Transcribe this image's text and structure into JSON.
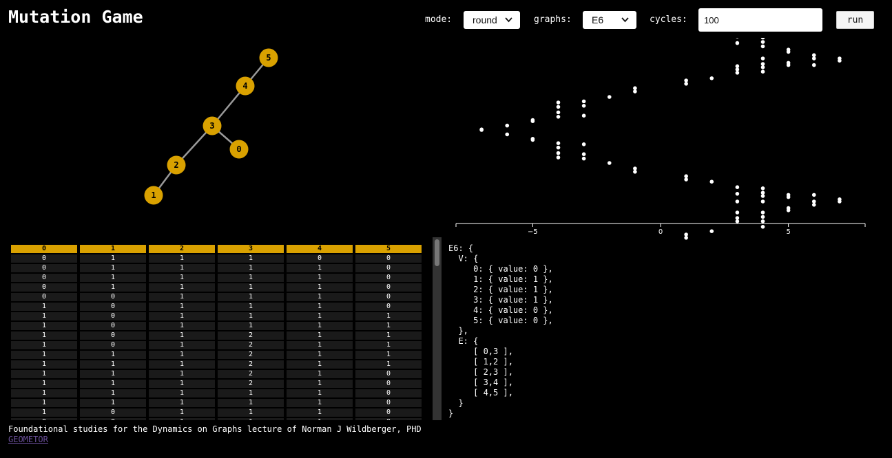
{
  "app": {
    "title": "Mutation Game"
  },
  "controls": {
    "mode_label": "mode:",
    "mode_value": "round",
    "graphs_label": "graphs:",
    "graphs_value": "E6",
    "cycles_label": "cycles:",
    "cycles_value": "100",
    "run_label": "run"
  },
  "colors": {
    "node": "#d9a100",
    "edge": "#9a9a9a",
    "header": "#d9a100",
    "link": "#6a4f9a"
  },
  "graph": {
    "nodes": [
      {
        "label": "0"
      },
      {
        "label": "1"
      },
      {
        "label": "2"
      },
      {
        "label": "3"
      },
      {
        "label": "4"
      },
      {
        "label": "5"
      }
    ],
    "edges": [
      [
        0,
        3
      ],
      [
        1,
        2
      ],
      [
        2,
        3
      ],
      [
        3,
        4
      ],
      [
        4,
        5
      ]
    ]
  },
  "chart_data": {
    "type": "scatter",
    "xlim": [
      -8,
      8
    ],
    "x_ticks": [
      -5,
      0,
      5
    ],
    "grid": false,
    "points": [
      [
        -7,
        0
      ],
      [
        -7,
        0.05
      ],
      [
        -6,
        0.4
      ],
      [
        -6,
        -0.4
      ],
      [
        -5,
        0.8
      ],
      [
        -5,
        0.9
      ],
      [
        -5,
        -0.8
      ],
      [
        -5,
        -0.9
      ],
      [
        -4,
        2.5
      ],
      [
        -4,
        2.1
      ],
      [
        -4,
        1.6
      ],
      [
        -4,
        1.2
      ],
      [
        -4,
        -1.2
      ],
      [
        -4,
        -1.6
      ],
      [
        -4,
        -2.1
      ],
      [
        -4,
        -2.5
      ],
      [
        -3,
        2.6
      ],
      [
        -3,
        2.2
      ],
      [
        -3,
        1.3
      ],
      [
        -3,
        -1.3
      ],
      [
        -3,
        -2.2
      ],
      [
        -3,
        -2.6
      ],
      [
        -2,
        3.0
      ],
      [
        -2,
        -3.0
      ],
      [
        -1,
        3.5
      ],
      [
        -1,
        3.8
      ],
      [
        -1,
        -3.5
      ],
      [
        -1,
        -3.8
      ],
      [
        1,
        4.2
      ],
      [
        1,
        4.5
      ],
      [
        1,
        -4.2
      ],
      [
        1,
        -4.5
      ],
      [
        1,
        -9.5
      ],
      [
        1,
        -9.8
      ],
      [
        2,
        4.7
      ],
      [
        2,
        -4.7
      ],
      [
        2,
        -9.2
      ],
      [
        3,
        8.5
      ],
      [
        3,
        7.9
      ],
      [
        3,
        5.8
      ],
      [
        3,
        5.2
      ],
      [
        3,
        5.5
      ],
      [
        3,
        -5.2
      ],
      [
        3,
        -5.8
      ],
      [
        3,
        -6.5
      ],
      [
        3,
        -7.5
      ],
      [
        3,
        -8.0
      ],
      [
        3,
        -8.3
      ],
      [
        4,
        8.4
      ],
      [
        4,
        8.0
      ],
      [
        4,
        7.6
      ],
      [
        4,
        6.5
      ],
      [
        4,
        6.0
      ],
      [
        4,
        5.7
      ],
      [
        4,
        5.3
      ],
      [
        4,
        -5.3
      ],
      [
        4,
        -5.7
      ],
      [
        4,
        -6.0
      ],
      [
        4,
        -6.5
      ],
      [
        4,
        -7.5
      ],
      [
        4,
        -7.9
      ],
      [
        4,
        -8.3
      ],
      [
        4,
        -8.8
      ],
      [
        5,
        7.3
      ],
      [
        5,
        7.1
      ],
      [
        5,
        6.1
      ],
      [
        5,
        5.9
      ],
      [
        5,
        -6.1
      ],
      [
        5,
        -5.9
      ],
      [
        5,
        -7.1
      ],
      [
        5,
        -7.3
      ],
      [
        6,
        6.8
      ],
      [
        6,
        6.5
      ],
      [
        6,
        5.9
      ],
      [
        6,
        -5.9
      ],
      [
        6,
        -6.5
      ],
      [
        6,
        -6.8
      ],
      [
        7,
        6.5
      ],
      [
        7,
        6.3
      ],
      [
        7,
        -6.3
      ],
      [
        7,
        -6.5
      ]
    ]
  },
  "table": {
    "headers": [
      "0",
      "1",
      "2",
      "3",
      "4",
      "5"
    ],
    "rows": [
      [
        "0",
        "1",
        "1",
        "1",
        "0",
        "0"
      ],
      [
        "0",
        "1",
        "1",
        "1",
        "1",
        "0"
      ],
      [
        "0",
        "1",
        "1",
        "1",
        "1",
        "0"
      ],
      [
        "0",
        "1",
        "1",
        "1",
        "1",
        "0"
      ],
      [
        "0",
        "0",
        "1",
        "1",
        "1",
        "0"
      ],
      [
        "1",
        "0",
        "1",
        "1",
        "1",
        "0"
      ],
      [
        "1",
        "0",
        "1",
        "1",
        "1",
        "1"
      ],
      [
        "1",
        "0",
        "1",
        "1",
        "1",
        "1"
      ],
      [
        "1",
        "0",
        "1",
        "2",
        "1",
        "1"
      ],
      [
        "1",
        "0",
        "1",
        "2",
        "1",
        "1"
      ],
      [
        "1",
        "1",
        "1",
        "2",
        "1",
        "1"
      ],
      [
        "1",
        "1",
        "1",
        "2",
        "1",
        "1"
      ],
      [
        "1",
        "1",
        "1",
        "2",
        "1",
        "0"
      ],
      [
        "1",
        "1",
        "1",
        "2",
        "1",
        "0"
      ],
      [
        "1",
        "1",
        "1",
        "1",
        "1",
        "0"
      ],
      [
        "1",
        "1",
        "1",
        "1",
        "1",
        "0"
      ],
      [
        "1",
        "0",
        "1",
        "1",
        "1",
        "0"
      ],
      [
        "0",
        "0",
        "1",
        "1",
        "1",
        "0"
      ]
    ]
  },
  "code_text": "E6: {\n  V: {\n     0: { value: 0 },\n     1: { value: 1 },\n     2: { value: 1 },\n     3: { value: 1 },\n     4: { value: 0 },\n     5: { value: 0 },\n  },\n  E: {\n     [ 0,3 ],\n     [ 1,2 ],\n     [ 2,3 ],\n     [ 3,4 ],\n     [ 4,5 ],\n  }\n}",
  "footer": {
    "text": "Foundational studies for the Dynamics on Graphs lecture of Norman J Wildberger, PHD",
    "link_label": "GEOMETOR"
  }
}
